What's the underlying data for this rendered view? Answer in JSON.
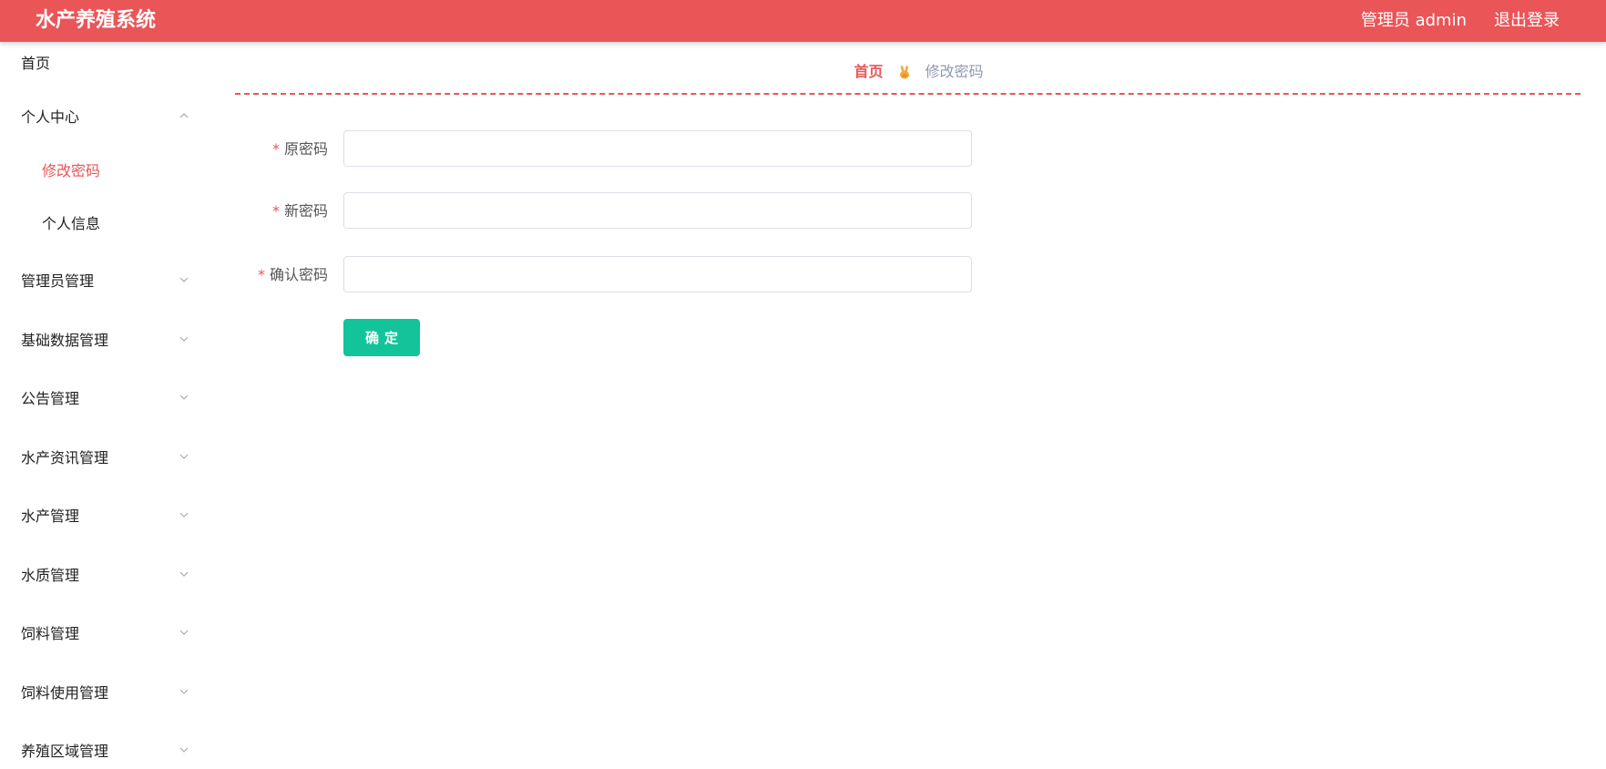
{
  "header": {
    "title": "水产养殖系统",
    "user_label": "管理员 admin",
    "logout_label": "退出登录",
    "accent_color": "#ea5558"
  },
  "sidebar": {
    "items": [
      {
        "label": "首页",
        "expandable": false
      },
      {
        "label": "个人中心",
        "expandable": true,
        "expanded": true,
        "children": [
          {
            "label": "修改密码",
            "active": true
          },
          {
            "label": "个人信息",
            "active": false
          }
        ]
      },
      {
        "label": "管理员管理",
        "expandable": true,
        "expanded": false
      },
      {
        "label": "基础数据管理",
        "expandable": true,
        "expanded": false
      },
      {
        "label": "公告管理",
        "expandable": true,
        "expanded": false
      },
      {
        "label": "水产资讯管理",
        "expandable": true,
        "expanded": false
      },
      {
        "label": "水产管理",
        "expandable": true,
        "expanded": false
      },
      {
        "label": "水质管理",
        "expandable": true,
        "expanded": false
      },
      {
        "label": "饲料管理",
        "expandable": true,
        "expanded": false
      },
      {
        "label": "饲料使用管理",
        "expandable": true,
        "expanded": false
      },
      {
        "label": "养殖区域管理",
        "expandable": true,
        "expanded": false
      }
    ]
  },
  "breadcrumb": {
    "home": "首页",
    "separator_icon": "victory-hand-icon",
    "current": "修改密码"
  },
  "form": {
    "required_mark": "*",
    "fields": [
      {
        "label": "原密码",
        "value": "",
        "placeholder": ""
      },
      {
        "label": "新密码",
        "value": "",
        "placeholder": ""
      },
      {
        "label": "确认密码",
        "value": "",
        "placeholder": ""
      }
    ],
    "submit_label": "确定",
    "submit_color": "#13c49a"
  }
}
